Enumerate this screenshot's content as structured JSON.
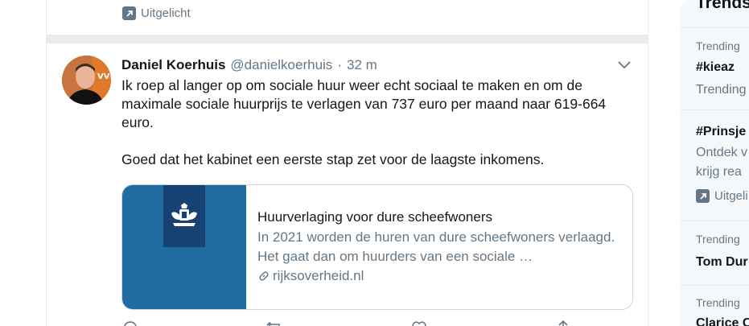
{
  "previous_tweet": {
    "featured_label": "Uitgelicht",
    "featured_icon": "arrow-up-right-icon"
  },
  "tweet": {
    "author_name": "Daniel Koerhuis",
    "author_handle": "@danielkoerhuis",
    "separator": "·",
    "time_ago": "32 m",
    "text_paragraph_1": "Ik roep al langer op om sociale huur weer echt sociaal te maken en om de maximale sociale huurprijs te verlagen van 737 euro per maand naar 619-664 euro.",
    "text_paragraph_2": "Goed dat het kabinet een eerste stap zet voor de laagste inkomens.",
    "card": {
      "title": "Huurverlaging voor dure scheefwoners",
      "description": "In 2021 worden de huren van dure scheefwoners verlaagd. Het gaat dan om huurders van een sociale …",
      "domain": "rijksoverheid.nl",
      "image_color": "#1e6ca0",
      "logo_bar_color": "#154273"
    },
    "action_icons": [
      "reply-icon",
      "retweet-icon",
      "like-icon",
      "share-icon"
    ]
  },
  "sidebar": {
    "title": "Trends",
    "trends": [
      {
        "meta": "Trending",
        "name": "#kieaz",
        "sub": "Trending"
      },
      {
        "name": "#Prinsje",
        "sub_1": "Ontdek v",
        "sub_2": "krijg rea",
        "featured": "Uitgeli"
      },
      {
        "meta": "Trending",
        "name": "Tom Dur"
      },
      {
        "meta": "Trending",
        "name": "Clarice C"
      }
    ]
  },
  "colors": {
    "text_primary": "#14171a",
    "text_secondary": "#657786",
    "border": "#e6ecf0"
  }
}
